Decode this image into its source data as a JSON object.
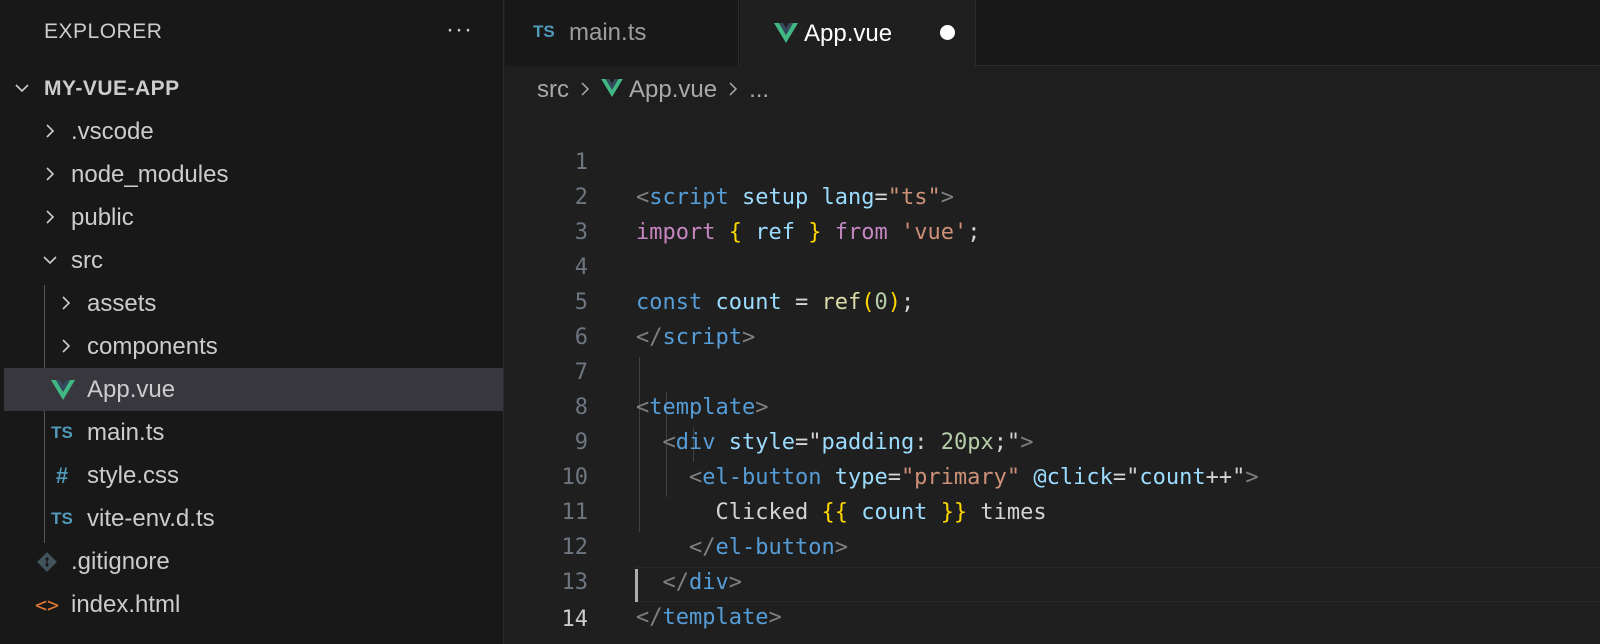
{
  "explorer": {
    "title": "EXPLORER",
    "more": "···",
    "root": "MY-VUE-APP",
    "items": [
      {
        "label": ".vscode",
        "icon": "chevron-right"
      },
      {
        "label": "node_modules",
        "icon": "chevron-right"
      },
      {
        "label": "public",
        "icon": "chevron-right"
      },
      {
        "label": "src",
        "icon": "chevron-down"
      },
      {
        "label": "assets",
        "icon": "chevron-right"
      },
      {
        "label": "components",
        "icon": "chevron-right"
      },
      {
        "label": "App.vue",
        "icon": "vue-icon"
      },
      {
        "label": "main.ts",
        "icon": "ts-icon",
        "badge": "TS"
      },
      {
        "label": "style.css",
        "icon": "hash-icon",
        "badge": "#"
      },
      {
        "label": "vite-env.d.ts",
        "icon": "ts-icon",
        "badge": "TS"
      },
      {
        "label": ".gitignore",
        "icon": "git-icon"
      },
      {
        "label": "index.html",
        "icon": "html-icon",
        "badge": "<>"
      }
    ]
  },
  "tabs": [
    {
      "label": "main.ts",
      "badge": "TS",
      "active": false
    },
    {
      "label": "App.vue",
      "active": true,
      "dirty": true
    }
  ],
  "breadcrumb": {
    "folder": "src",
    "file": "App.vue",
    "more": "..."
  },
  "editor": {
    "current_line": 14,
    "line_numbers": [
      "1",
      "2",
      "3",
      "4",
      "5",
      "6",
      "7",
      "8",
      "9",
      "10",
      "11",
      "12",
      "13",
      "14"
    ]
  },
  "colors": {
    "vue_green": "#41b883",
    "ts_blue": "#519aba",
    "html_orange": "#e37933",
    "selection": "#37373d"
  }
}
